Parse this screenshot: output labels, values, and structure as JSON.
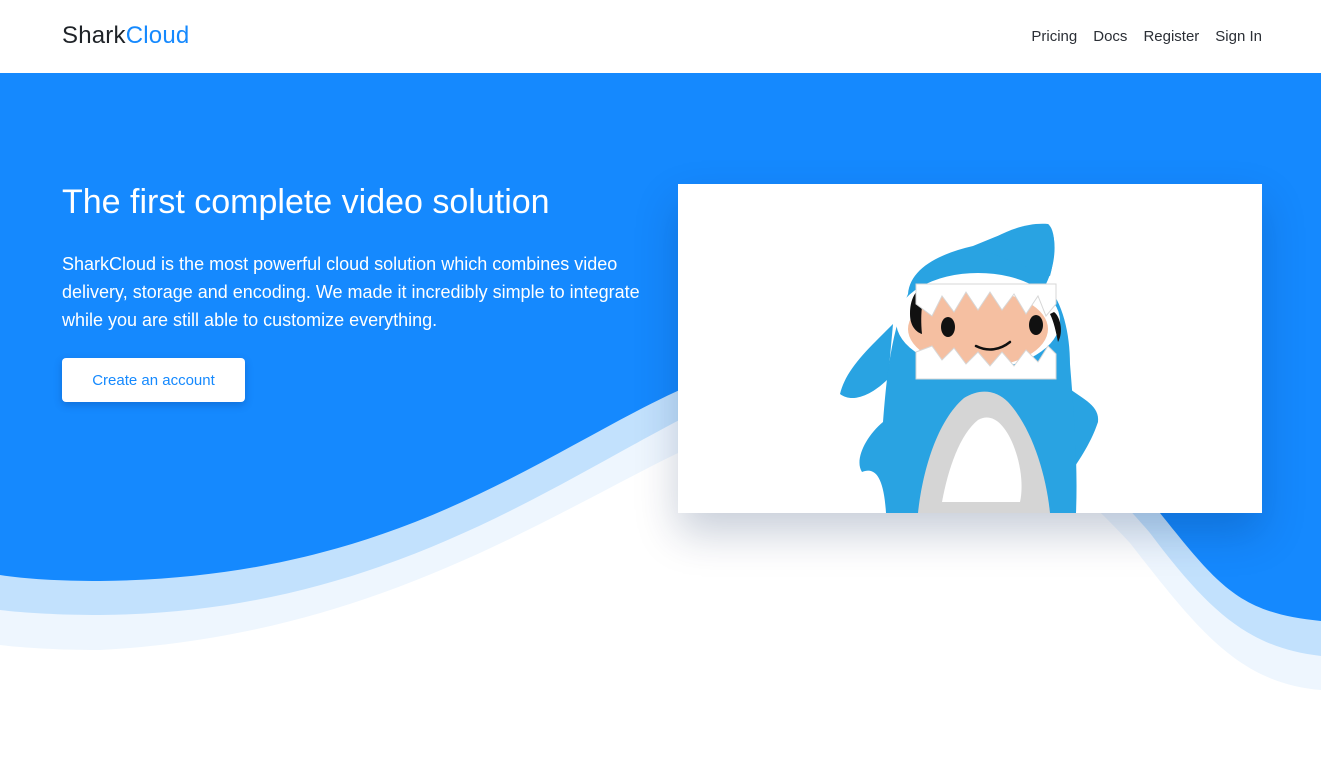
{
  "header": {
    "brand": {
      "part1": "Shark",
      "part2": "Cloud"
    },
    "nav": [
      {
        "label": "Pricing"
      },
      {
        "label": "Docs"
      },
      {
        "label": "Register"
      },
      {
        "label": "Sign In"
      }
    ]
  },
  "hero": {
    "title": "The first complete video solution",
    "description": "SharkCloud is the most powerful cloud solution which combines video delivery, storage and encoding. We made it incredibly simple to integrate while you are still able to customize everything.",
    "cta_label": "Create an account",
    "illustration": "shark-mascot"
  },
  "colors": {
    "brand_blue": "#1589fe",
    "wave_light": "#c2e1fd",
    "wave_lighter": "#eef6fe",
    "mascot_blue": "#29a3e2",
    "text_dark": "#1f2328"
  }
}
